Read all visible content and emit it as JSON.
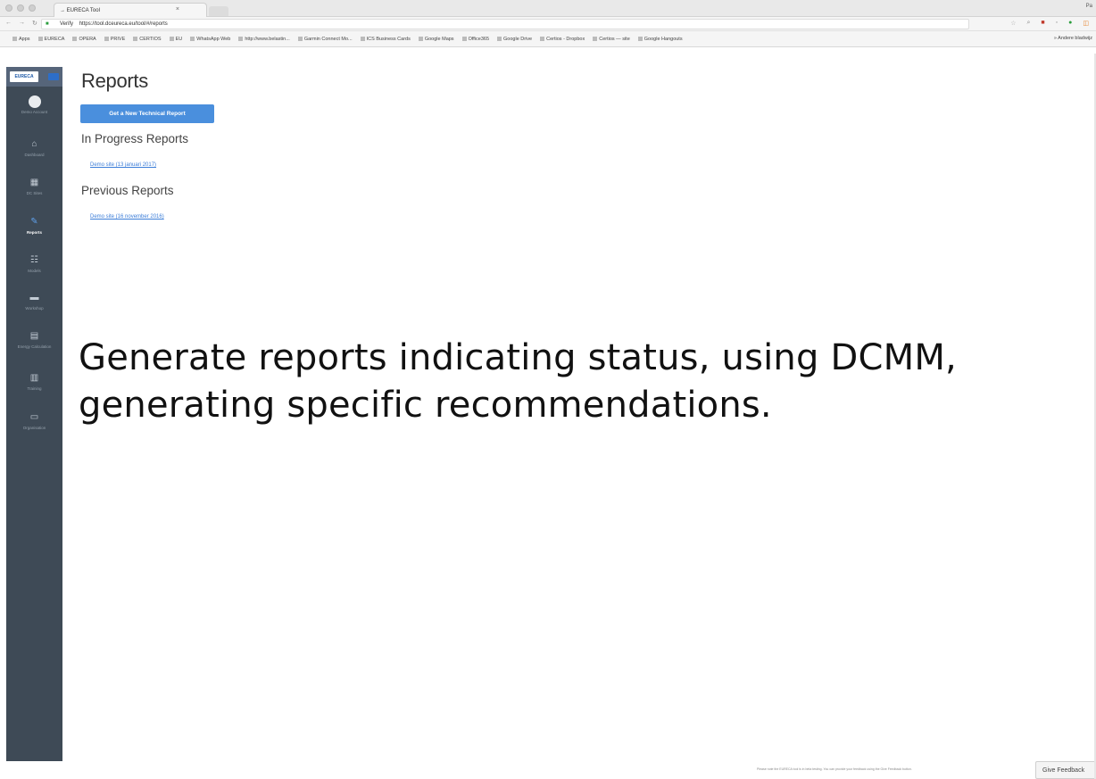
{
  "browser": {
    "tab_title": "→ EURECA Tool",
    "tab_close": "×",
    "user_name": "Pa",
    "url_prefix": "Verify",
    "url": "https://tool.dceureca.eu/tool/#/reports",
    "bookmarks": [
      "Apps",
      "EURECA",
      "OPERA",
      "PRIVE",
      "CERTIOS",
      "EU",
      "WhatsApp Web",
      "http://www.belastin...",
      "Garmin Connect Mo...",
      "ICS Business Cards",
      "Google Maps",
      "Office365",
      "Google Drive",
      "Certios - Dropbox",
      "Certios — site",
      "Google Hangouts"
    ],
    "other_bookmarks": "» Andere bladwijz"
  },
  "sidebar": {
    "logo": "EURECA",
    "items": [
      {
        "label": "Demo Account",
        "icon": "avatar"
      },
      {
        "label": "Dashboard",
        "icon": "home-icon"
      },
      {
        "label": "DC Sites",
        "icon": "building-icon"
      },
      {
        "label": "Reports",
        "icon": "edit-icon",
        "active": true
      },
      {
        "label": "Models",
        "icon": "list-icon"
      },
      {
        "label": "Workshop",
        "icon": "briefcase-icon"
      },
      {
        "label": "Energy Calculation",
        "icon": "calculator-icon"
      },
      {
        "label": "Training",
        "icon": "university-icon"
      },
      {
        "label": "Organisation",
        "icon": "document-icon"
      }
    ]
  },
  "main": {
    "title": "Reports",
    "new_report_button": "Get a New Technical Report",
    "in_progress_title": "In Progress Reports",
    "in_progress_link": "Demo site (13 januari 2017)",
    "previous_title": "Previous Reports",
    "previous_link": "Demo site (16 november 2016)"
  },
  "caption": {
    "line1": "Generate reports indicating status, using DCMM,",
    "line2": "generating specific recommendations."
  },
  "footer": {
    "note": "Please note the EURECA tool is in beta testing. You can provide your feedback using the Give Feedback button.",
    "feedback_button": "Give Feedback"
  }
}
